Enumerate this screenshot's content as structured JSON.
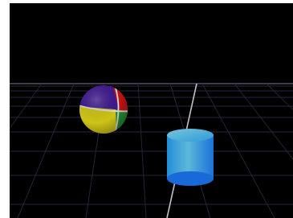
{
  "viewport": {
    "background": "#000000",
    "grid_color": "#2f2f4a",
    "horizon_color": "#6a6a7a"
  },
  "objects": {
    "sphere": {
      "shape": "sphere",
      "colors": [
        "#4a1ea8",
        "#e01818",
        "#2ca43c",
        "#f2e61a"
      ]
    },
    "cylinder": {
      "shape": "cylinder",
      "colors": [
        "#3cc4ff",
        "#1e7cff"
      ]
    }
  }
}
